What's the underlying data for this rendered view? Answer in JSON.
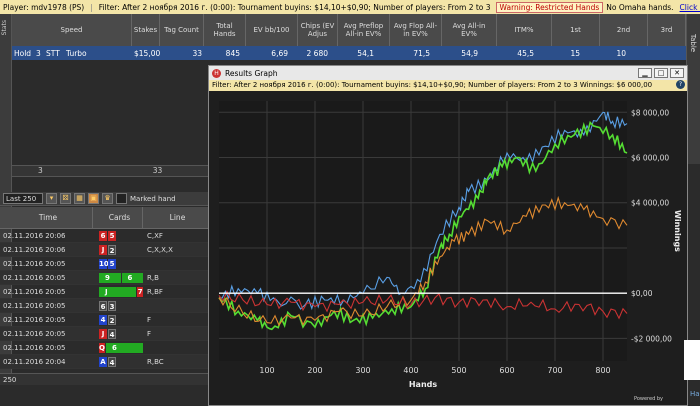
{
  "topbar": {
    "player": "Player: mdv1978 (PS)",
    "filter": "Filter: After 2 ноября 2016 г. (0:00): Tournament buyins: $14,10+$0,90; Number of players: From 2 to 3",
    "warning": "Warning: Restricted Hands",
    "no_omaha": "No Omaha hands.",
    "unlock": "Click here to unlock"
  },
  "left_strip_label": "Stats",
  "right_strip_label": "Table",
  "stats": {
    "headers": [
      "Speed",
      "Stakes",
      "Tag Count",
      "Total Hands",
      "EV bb/100",
      "Chips (EV Adjus",
      "Avg Preflop All-in EV%",
      "Avg Flop All-in EV%",
      "Avg All-in EV%",
      "ITM%",
      "1st",
      "2nd",
      "3rd"
    ],
    "row": [
      "Hold",
      "3",
      "STT",
      "Turbo",
      "$15,00",
      "33",
      "845",
      "6,69",
      "2 680",
      "54,1",
      "71,5",
      "54,9",
      "45,5",
      "15",
      "10"
    ],
    "footer": [
      "3",
      "33"
    ]
  },
  "hands": {
    "filter_value": "Last 250",
    "marked_label": "Marked hand",
    "headers": {
      "time": "Time",
      "cards": "Cards",
      "line": "Line"
    },
    "rows": [
      {
        "time": "02.11.2016 20:06",
        "cards": [
          [
            "6",
            "h"
          ],
          [
            "5",
            "h"
          ]
        ],
        "line": "C,XF"
      },
      {
        "time": "02.11.2016 20:06",
        "cards": [
          [
            "J",
            "h"
          ],
          [
            "2",
            "s"
          ]
        ],
        "line": "C,X,X,X"
      },
      {
        "time": "02.11.2016 20:05",
        "cards": [
          [
            "10",
            "d"
          ],
          [
            "5",
            "d"
          ]
        ],
        "line": ""
      },
      {
        "time": "02.11.2016 20:05",
        "cards": [
          [
            "9",
            "c"
          ],
          [
            "6",
            "c"
          ]
        ],
        "line": "R,B"
      },
      {
        "time": "02.11.2016 20:05",
        "cards": [
          [
            "J",
            "c"
          ],
          [
            "7",
            "h"
          ]
        ],
        "line": "R,BF"
      },
      {
        "time": "02.11.2016 20:05",
        "cards": [
          [
            "6",
            "s"
          ],
          [
            "3",
            "s"
          ]
        ],
        "line": ""
      },
      {
        "time": "02.11.2016 20:05",
        "cards": [
          [
            "4",
            "d"
          ],
          [
            "2",
            "s"
          ]
        ],
        "line": "F"
      },
      {
        "time": "02.11.2016 20:05",
        "cards": [
          [
            "J",
            "h"
          ],
          [
            "4",
            "s"
          ]
        ],
        "line": "F"
      },
      {
        "time": "02.11.2016 20:05",
        "cards": [
          [
            "Q",
            "h"
          ],
          [
            "6",
            "c"
          ]
        ],
        "line": ""
      },
      {
        "time": "02.11.2016 20:04",
        "cards": [
          [
            "A",
            "d"
          ],
          [
            "4",
            "s"
          ]
        ],
        "line": "R,BC"
      }
    ],
    "pager": "250"
  },
  "graph": {
    "title": "Results Graph",
    "filter": "Filter: After 2 ноября 2016 г. (0:00): Tournament buyins: $14,10+$0,90; Number of players: From 2 to 3 Winnings: $6 000,00",
    "xlabel": "Hands",
    "ylabel": "Winnings",
    "powered": "Powered by",
    "ha": "Ha"
  },
  "chart_data": {
    "type": "line",
    "xlabel": "Hands",
    "ylabel": "Winnings",
    "xlim": [
      0,
      850
    ],
    "ylim": [
      -3000,
      8500
    ],
    "x_ticks": [
      100,
      200,
      300,
      400,
      500,
      600,
      700,
      800
    ],
    "y_ticks": [
      -2000,
      0,
      4000,
      6000,
      8000
    ],
    "y_tick_labels": [
      "-$2 000,00",
      "$0,00",
      "$4 000,00",
      "$6 000,00",
      "$8 000,00"
    ],
    "colors": {
      "blue": "#5aa0e6",
      "green": "#55dd33",
      "orange": "#e08a30",
      "red": "#cc3333",
      "zero": "#ffffff"
    },
    "series": [
      {
        "color": "blue",
        "points": [
          [
            0,
            -200
          ],
          [
            40,
            200
          ],
          [
            80,
            0
          ],
          [
            120,
            -300
          ],
          [
            180,
            -500
          ],
          [
            220,
            -300
          ],
          [
            260,
            -300
          ],
          [
            300,
            0
          ],
          [
            350,
            700
          ],
          [
            380,
            0
          ],
          [
            420,
            500
          ],
          [
            460,
            2600
          ],
          [
            500,
            3800
          ],
          [
            520,
            4500
          ],
          [
            560,
            5000
          ],
          [
            600,
            6200
          ],
          [
            640,
            5800
          ],
          [
            680,
            6500
          ],
          [
            720,
            7200
          ],
          [
            760,
            7000
          ],
          [
            800,
            8000
          ],
          [
            820,
            7600
          ],
          [
            850,
            7500
          ]
        ]
      },
      {
        "color": "green",
        "points": [
          [
            0,
            -200
          ],
          [
            40,
            -800
          ],
          [
            80,
            -1200
          ],
          [
            110,
            -1600
          ],
          [
            150,
            -1000
          ],
          [
            200,
            -1500
          ],
          [
            240,
            -800
          ],
          [
            280,
            -1200
          ],
          [
            320,
            -1100
          ],
          [
            360,
            -700
          ],
          [
            400,
            -600
          ],
          [
            430,
            200
          ],
          [
            460,
            2000
          ],
          [
            480,
            2600
          ],
          [
            510,
            3600
          ],
          [
            540,
            4200
          ],
          [
            560,
            5100
          ],
          [
            590,
            5600
          ],
          [
            620,
            6000
          ],
          [
            660,
            5400
          ],
          [
            700,
            6600
          ],
          [
            740,
            7000
          ],
          [
            780,
            7400
          ],
          [
            820,
            7000
          ],
          [
            850,
            6200
          ]
        ]
      },
      {
        "color": "orange",
        "points": [
          [
            0,
            -200
          ],
          [
            50,
            -900
          ],
          [
            100,
            -1300
          ],
          [
            150,
            -1100
          ],
          [
            200,
            -1200
          ],
          [
            250,
            -800
          ],
          [
            300,
            -1000
          ],
          [
            350,
            -600
          ],
          [
            400,
            -300
          ],
          [
            430,
            500
          ],
          [
            460,
            1600
          ],
          [
            490,
            2300
          ],
          [
            520,
            2600
          ],
          [
            560,
            3200
          ],
          [
            600,
            2800
          ],
          [
            640,
            3400
          ],
          [
            680,
            3900
          ],
          [
            720,
            4000
          ],
          [
            760,
            3700
          ],
          [
            800,
            3300
          ],
          [
            850,
            3000
          ]
        ]
      },
      {
        "color": "red",
        "points": [
          [
            0,
            -100
          ],
          [
            50,
            -300
          ],
          [
            100,
            -500
          ],
          [
            150,
            -400
          ],
          [
            200,
            -600
          ],
          [
            250,
            -500
          ],
          [
            300,
            -400
          ],
          [
            350,
            -300
          ],
          [
            400,
            -500
          ],
          [
            450,
            -200
          ],
          [
            500,
            -400
          ],
          [
            550,
            -300
          ],
          [
            600,
            -600
          ],
          [
            650,
            -400
          ],
          [
            700,
            -700
          ],
          [
            750,
            -500
          ],
          [
            800,
            -800
          ],
          [
            850,
            -900
          ]
        ]
      }
    ]
  }
}
